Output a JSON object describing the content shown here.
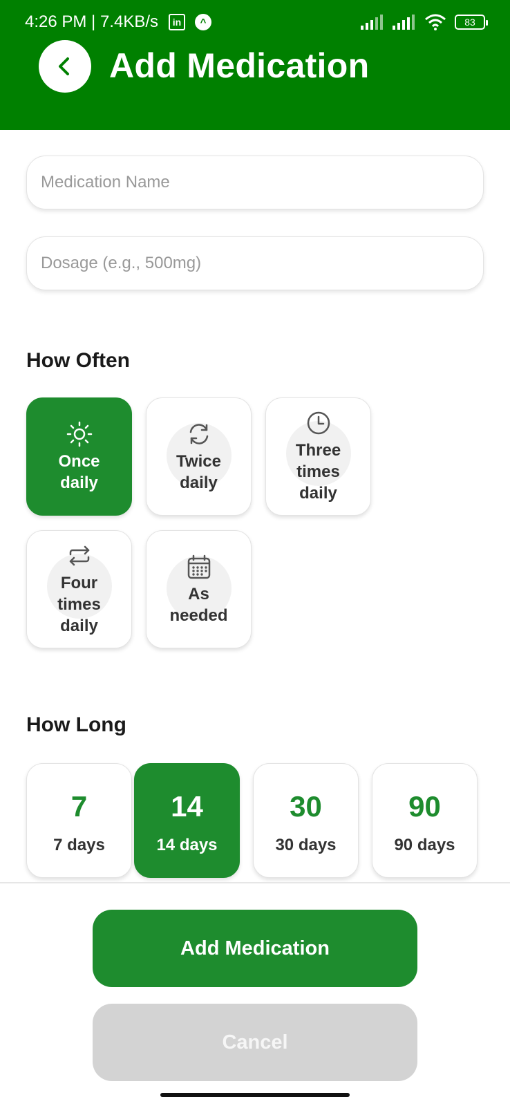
{
  "status_bar": {
    "time_speed": "4:26 PM | 7.4KB/s",
    "battery": "83"
  },
  "header": {
    "title": "Add Medication",
    "back_icon": "chevron-left-icon"
  },
  "form": {
    "medication_name_placeholder": "Medication Name",
    "dosage_placeholder": "Dosage (e.g., 500mg)"
  },
  "frequency": {
    "title": "How Often",
    "options": [
      {
        "label": "Once daily",
        "icon": "sun-icon",
        "selected": true
      },
      {
        "label": "Twice daily",
        "icon": "refresh-icon",
        "selected": false
      },
      {
        "label": "Three times daily",
        "icon": "clock-icon",
        "selected": false
      },
      {
        "label": "Four times daily",
        "icon": "repeat-icon",
        "selected": false
      },
      {
        "label": "As needed",
        "icon": "calendar-icon",
        "selected": false
      }
    ]
  },
  "duration": {
    "title": "How Long",
    "options": [
      {
        "value": "7",
        "label": "7 days",
        "selected": false
      },
      {
        "value": "14",
        "label": "14 days",
        "selected": true
      },
      {
        "value": "30",
        "label": "30 days",
        "selected": false
      },
      {
        "value": "90",
        "label": "90 days",
        "selected": false
      }
    ]
  },
  "actions": {
    "add_label": "Add Medication",
    "cancel_label": "Cancel"
  },
  "colors": {
    "header": "#008000",
    "accent": "#1e8c2e",
    "cancel": "#d3d3d3"
  }
}
